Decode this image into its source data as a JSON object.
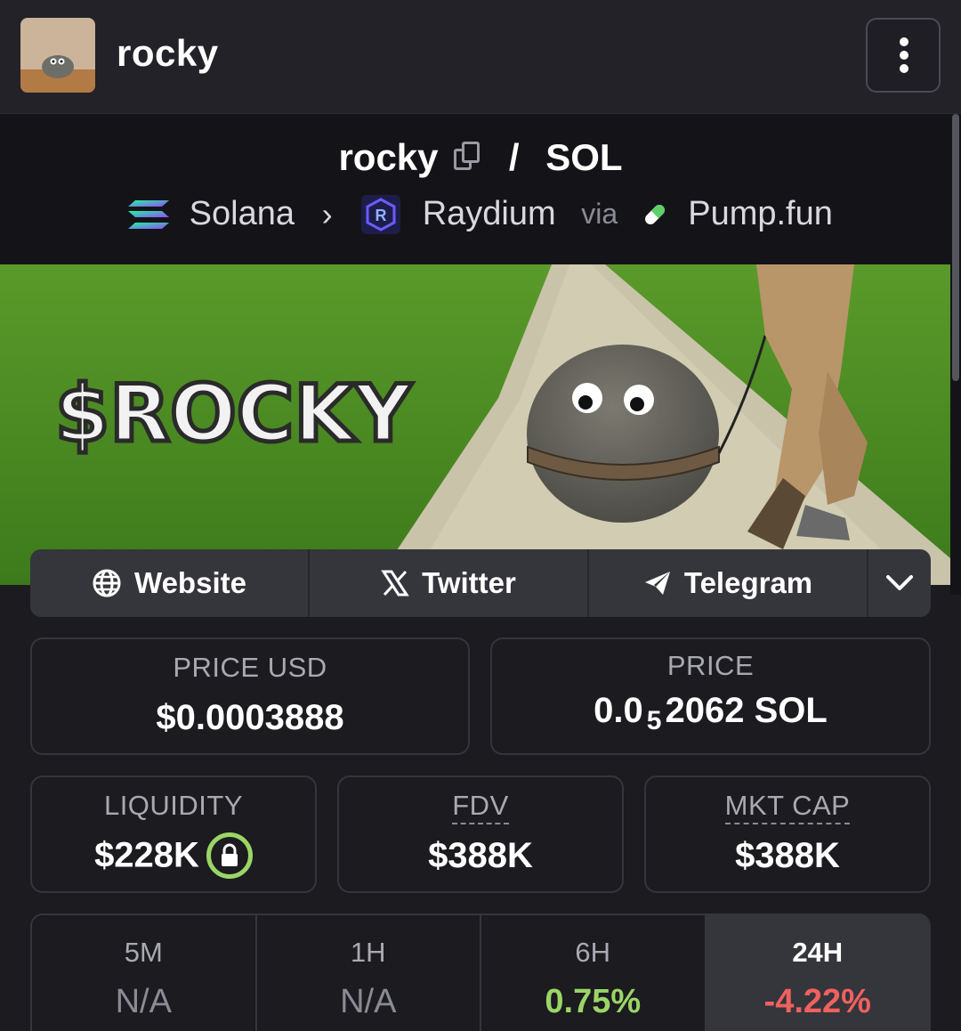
{
  "header": {
    "title": "rocky",
    "menu_icon": "more-vertical-icon"
  },
  "pair": {
    "base": "rocky",
    "separator": "/",
    "quote": "SOL",
    "chain": "Solana",
    "dex": "Raydium",
    "via_label": "via",
    "launchpad": "Pump.fun"
  },
  "banner": {
    "text": "$ROCKY"
  },
  "links": [
    {
      "label": "Website",
      "icon": "globe-icon"
    },
    {
      "label": "Twitter",
      "icon": "x-icon"
    },
    {
      "label": "Telegram",
      "icon": "telegram-icon"
    }
  ],
  "stats": {
    "price_usd": {
      "label": "PRICE USD",
      "value": "$0.0003888"
    },
    "price_native": {
      "label": "PRICE",
      "prefix": "0.0",
      "subscript": "5",
      "digits": "2062",
      "unit": "SOL"
    },
    "liquidity": {
      "label": "LIQUIDITY",
      "value": "$228K"
    },
    "fdv": {
      "label": "FDV",
      "value": "$388K"
    },
    "mkt_cap": {
      "label": "MKT CAP",
      "value": "$388K"
    }
  },
  "timeframes": [
    {
      "label": "5M",
      "value": "N/A",
      "status": "neutral"
    },
    {
      "label": "1H",
      "value": "N/A",
      "status": "neutral"
    },
    {
      "label": "6H",
      "value": "0.75%",
      "status": "positive"
    },
    {
      "label": "24H",
      "value": "-4.22%",
      "status": "negative",
      "selected": true
    }
  ],
  "colors": {
    "positive": "#9bd565",
    "negative": "#f0615f",
    "neutral": "#8b8b94"
  }
}
